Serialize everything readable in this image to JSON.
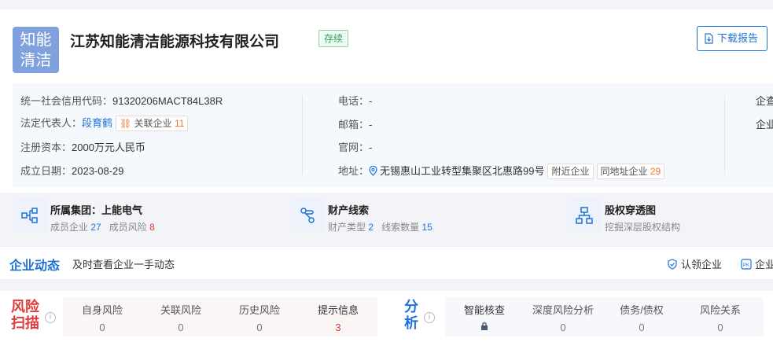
{
  "company": {
    "logo_text": "知能清洁",
    "name": "江苏知能清洁能源科技有限公司",
    "status": "存续",
    "download_label": "下载报告"
  },
  "info_left": {
    "credit_code_label": "统一社会信用代码：",
    "credit_code": "91320206MACT84L38R",
    "rep_label": "法定代表人：",
    "rep_name": "段育鹤",
    "related_label": "关联企业",
    "related_count": "11",
    "capital_label": "注册资本：",
    "capital": "2000万元人民币",
    "date_label": "成立日期：",
    "date": "2023-08-29"
  },
  "info_mid": {
    "phone_label": "电话：",
    "phone": "-",
    "email_label": "邮箱：",
    "email": "-",
    "web_label": "官网：",
    "web": "-",
    "addr_label": "地址：",
    "addr": "无锡惠山工业转型集聚区北惠路99号",
    "nearby_label": "附近企业",
    "same_addr_label": "同地址企业",
    "same_addr_count": "29"
  },
  "info_right": {
    "r1": "企查",
    "r2": "企业"
  },
  "cards": {
    "group_title": "所属集团：上能电气",
    "group_sub1_label": "成员企业",
    "group_sub1_val": "27",
    "group_sub2_label": "成员风险",
    "group_sub2_val": "8",
    "asset_title": "财产线索",
    "asset_sub1_label": "财产类型",
    "asset_sub1_val": "2",
    "asset_sub2_label": "线索数量",
    "asset_sub2_val": "15",
    "equity_title": "股权穿透图",
    "equity_sub": "挖掘深层股权结构"
  },
  "dynamics": {
    "title": "企业动态",
    "subtitle": "及时查看企业一手动态",
    "claim_label": "认领企业",
    "pk_label": "企业"
  },
  "risk": {
    "label": "风险扫描",
    "items": [
      {
        "label": "自身风险",
        "value": "0"
      },
      {
        "label": "关联风险",
        "value": "0"
      },
      {
        "label": "历史风险",
        "value": "0"
      },
      {
        "label": "提示信息",
        "value": "3"
      }
    ]
  },
  "analysis": {
    "label": "分析",
    "items": [
      {
        "label": "智能核查",
        "value": ""
      },
      {
        "label": "深度风险分析",
        "value": "0"
      },
      {
        "label": "债务/债权",
        "value": "0"
      },
      {
        "label": "风险关系",
        "value": "0"
      }
    ]
  },
  "colors": {
    "accent": "#1e71d8",
    "risk": "#e03a3a",
    "status": "#27a155",
    "warn": "#f06f2c"
  }
}
